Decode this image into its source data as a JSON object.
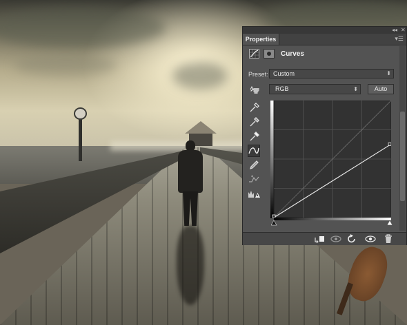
{
  "panel": {
    "tab_label": "Properties",
    "adjustment_title": "Curves",
    "preset_label": "Preset:",
    "preset_value": "Custom",
    "channel_value": "RGB",
    "auto_label": "Auto",
    "curve_points": [
      [
        0,
        0
      ],
      [
        255,
        160
      ]
    ]
  },
  "icons": {
    "titlebar": [
      "collapse-icon",
      "close-icon"
    ],
    "tab_menu": "panel-menu-icon",
    "header": [
      "curves-adjustment-icon",
      "layer-mask-icon"
    ],
    "tools": [
      "on-image-adjust-icon",
      "sample-black-point-eyedropper-icon",
      "sample-gray-point-eyedropper-icon",
      "sample-white-point-eyedropper-icon",
      "edit-points-curve-icon",
      "draw-pencil-icon",
      "smooth-curve-icon",
      "clipping-warning-icon"
    ],
    "bottom": [
      "clip-to-layer-icon",
      "view-previous-state-icon",
      "reset-icon",
      "visibility-eye-icon",
      "trash-icon"
    ]
  },
  "colors": {
    "panel_bg": "#535353",
    "curve_bg": "#323232",
    "curve_line": "#e6e6e6"
  }
}
